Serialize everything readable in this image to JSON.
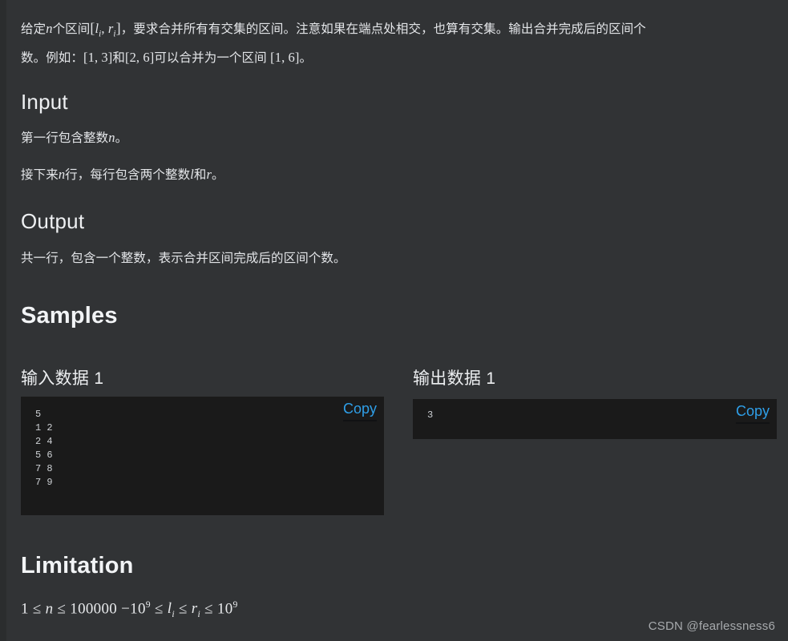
{
  "problem": {
    "statement": {
      "line1_pre": "给定",
      "line1_var_n": "n",
      "line1_mid": "个区间",
      "line1_interval_open": "[",
      "line1_l": "l",
      "line1_l_sub": "i",
      "line1_comma": ", ",
      "line1_r": "r",
      "line1_r_sub": "i",
      "line1_interval_close": "]",
      "line1_post": "，要求合并所有有交集的区间。注意如果在端点处相交，也算有交集。输出合并完成后的区间个",
      "line2_pre": "数。例如：",
      "line2_interval_a": "[1, 3]",
      "line2_mid": "和",
      "line2_interval_b": "[2, 6]",
      "line2_post": "可以合并为一个区间 ",
      "line2_interval_c": "[1, 6]",
      "line2_end": "。"
    },
    "input_section": {
      "heading": "Input",
      "line1_pre": "第一行包含整数",
      "line1_var": "n",
      "line1_post": "。",
      "line2_pre": "接下来",
      "line2_var_n": "n",
      "line2_mid": "行，每行包含两个整数",
      "line2_var_l": "l",
      "line2_and": "和",
      "line2_var_r": "r",
      "line2_post": "。"
    },
    "output_section": {
      "heading": "Output",
      "text": "共一行，包含一个整数，表示合并区间完成后的区间个数。"
    },
    "samples_section": {
      "heading": "Samples",
      "input_sample": {
        "title": "输入数据 1",
        "copy_label": "Copy",
        "content": "5\n1 2\n2 4\n5 6\n7 8\n7 9"
      },
      "output_sample": {
        "title": "输出数据 1",
        "copy_label": "Copy",
        "content": "3"
      }
    },
    "limitation_section": {
      "heading": "Limitation",
      "formula_1_left": "1",
      "formula_le1": " ≤ ",
      "formula_n": "n",
      "formula_le2": " ≤ ",
      "formula_100000": "100000",
      "formula_neg": " −10",
      "formula_exp1": "9",
      "formula_le3": " ≤ ",
      "formula_l": "l",
      "formula_l_sub": "i",
      "formula_le4": " ≤ ",
      "formula_r": "r",
      "formula_r_sub": "i",
      "formula_le5": " ≤ ",
      "formula_10": "10",
      "formula_exp2": "9"
    },
    "watermark": "CSDN @fearlessness6"
  },
  "colors": {
    "page_background": "#313335",
    "code_background": "#1a1a1a",
    "link_blue": "#2f9fe8",
    "text": "#e3e5e8",
    "watermark": "#a7aaad"
  }
}
